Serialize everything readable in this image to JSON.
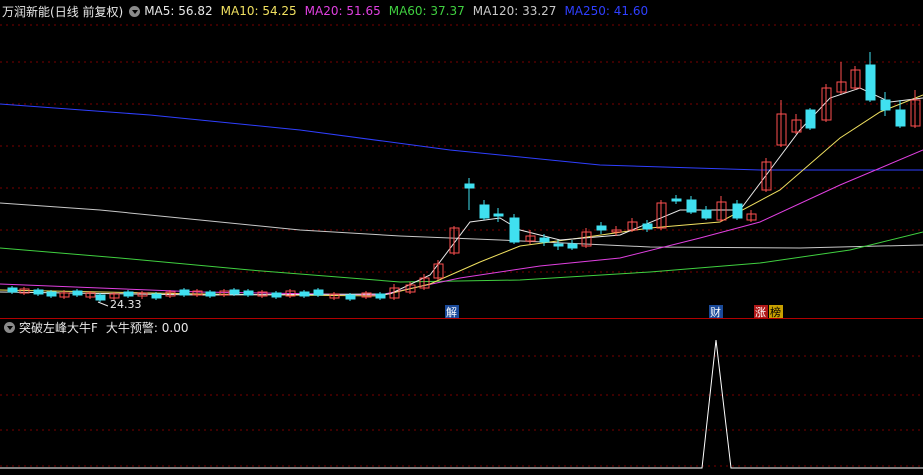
{
  "main_panel": {
    "stock_title": "万润新能",
    "period_label": "(日线 前复权)",
    "moving_averages": [
      {
        "label": "MA5: 56.82",
        "color": "#e8e8e8"
      },
      {
        "label": "MA10: 54.25",
        "color": "#f0e060"
      },
      {
        "label": "MA20: 51.65",
        "color": "#e040e0"
      },
      {
        "label": "MA60: 37.37",
        "color": "#40d040"
      },
      {
        "label": "MA120: 33.27",
        "color": "#c8c8c8"
      },
      {
        "label": "MA250: 41.60",
        "color": "#2f3fff"
      }
    ],
    "low_price_marker": "24.33",
    "event_markers": [
      {
        "label": "解",
        "bg": "#1a4a9a",
        "color": "#fff"
      },
      {
        "label": "财",
        "bg": "#1a4a9a",
        "color": "#fff"
      },
      {
        "label": "涨",
        "bg": "#b01818",
        "color": "#fff"
      },
      {
        "label": "榜",
        "bg": "#c8a000",
        "color": "#000"
      }
    ],
    "colors": {
      "up": "#ff5050",
      "down": "#40e0f0",
      "grid": "#7a0000"
    }
  },
  "sub_panel": {
    "indicator_title": "突破左峰大牛F",
    "indicator_value": "大牛预警: 0.00",
    "spike_color": "#ffffff"
  }
}
